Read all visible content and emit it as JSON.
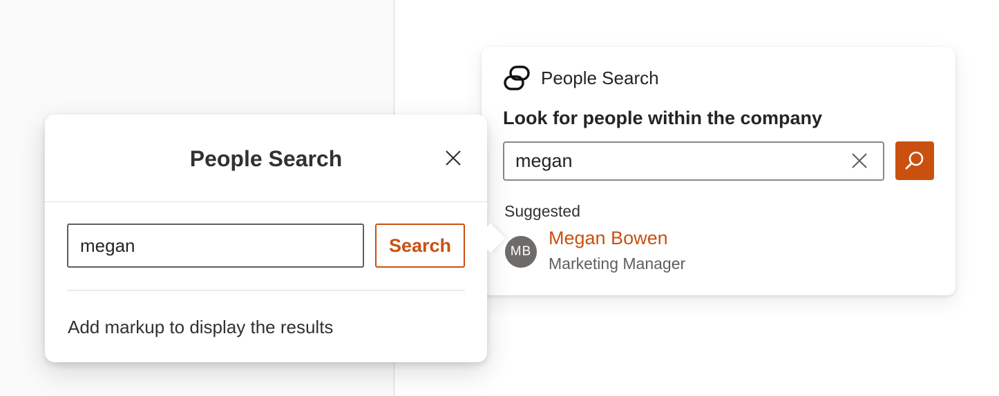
{
  "card": {
    "app_title": "People Search",
    "app_icon": "people-search-logo-icon",
    "heading": "Look for people within the company",
    "search_value": "megan",
    "clear_icon": "close-icon",
    "search_button_icon": "search-icon",
    "suggested_label": "Suggested",
    "results": [
      {
        "initials": "MB",
        "name": "Megan Bowen",
        "job_title": "Marketing Manager"
      }
    ]
  },
  "dialog": {
    "title": "People Search",
    "close_icon": "close-icon",
    "search_value": "megan",
    "search_button_label": "Search",
    "results_placeholder": "Add markup to display the results"
  },
  "colors": {
    "accent": "#ca5010",
    "avatar_bg": "#6e6b69",
    "text_primary": "#242424",
    "text_secondary": "#605e5c"
  }
}
